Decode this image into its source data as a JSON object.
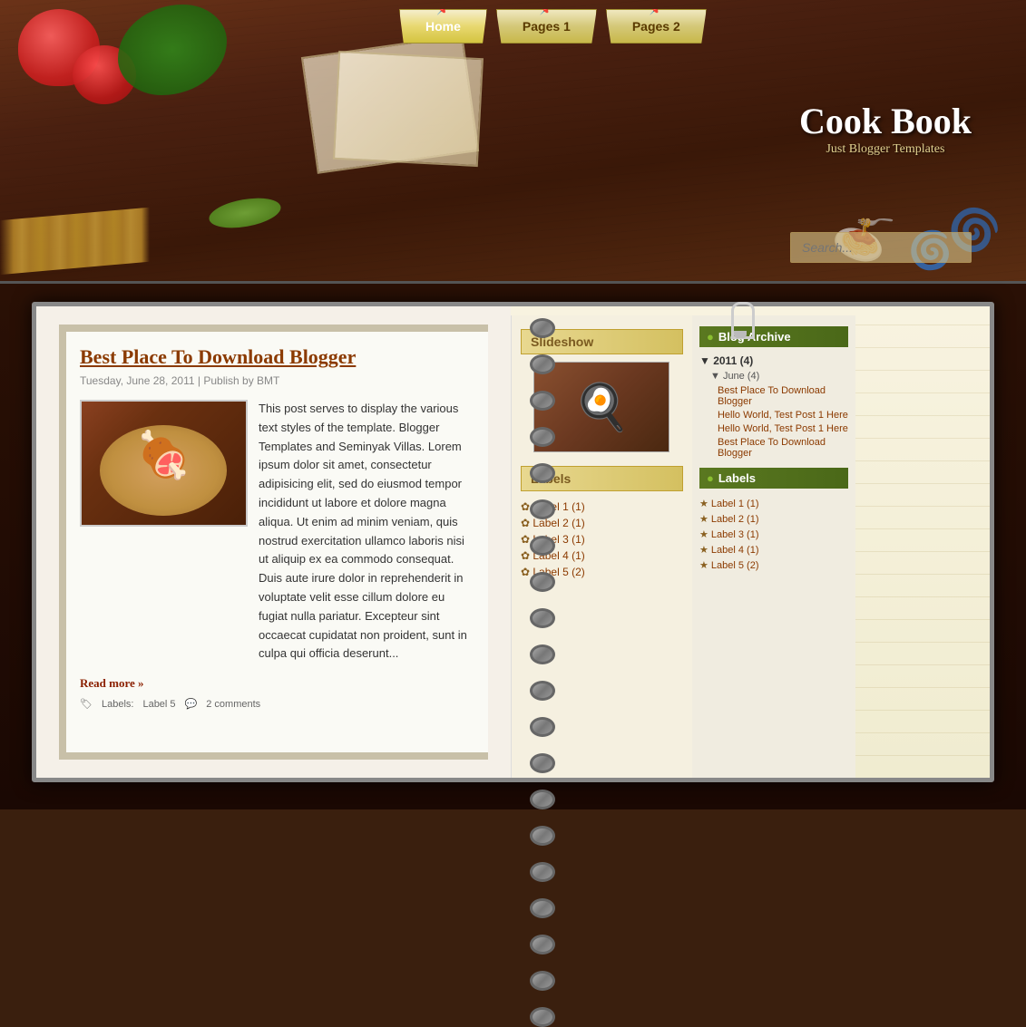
{
  "site": {
    "title": "Cook Book",
    "tagline": "Just Blogger Templates"
  },
  "nav": {
    "items": [
      {
        "label": "Home",
        "active": true
      },
      {
        "label": "Pages 1",
        "active": false
      },
      {
        "label": "Pages 2",
        "active": false
      }
    ]
  },
  "search": {
    "placeholder": "Search..."
  },
  "post": {
    "title": "Best Place To Download Blogger",
    "meta_date": "Tuesday, June 28, 2011",
    "meta_separator": " | ",
    "meta_publish": "Publish by BMT",
    "body_text": "This post serves to display the various text styles of the template. Blogger Templates and Seminyak Villas. Lorem ipsum dolor sit amet, consectetur adipisicing elit, sed do eiusmod tempor incididunt ut labore et dolore magna aliqua. Ut enim ad minim veniam, quis nostrud exercitation ullamco laboris nisi ut aliquip ex ea commodo consequat. Duis aute irure dolor in reprehenderit in voluptate velit esse cillum dolore eu fugiat nulla pariatur. Excepteur sint occaecat cupidatat non proident, sunt in culpa qui officia deserunt...",
    "read_more": "Read more »",
    "labels_prefix": "Labels:",
    "labels_value": "Label 5",
    "comments": "2 comments"
  },
  "slideshow": {
    "title": "Slideshow"
  },
  "labels_widget": {
    "title": "Labels",
    "items": [
      {
        "label": "Label 1",
        "count": "(1)"
      },
      {
        "label": "Label 2",
        "count": "(1)"
      },
      {
        "label": "Label 3",
        "count": "(1)"
      },
      {
        "label": "Label 4",
        "count": "(1)"
      },
      {
        "label": "Label 5",
        "count": "(2)"
      }
    ]
  },
  "blog_archive": {
    "title": "Blog Archive",
    "year": "2011 (4)",
    "month": "June (4)",
    "posts": [
      "Best Place To Download Blogger",
      "Hello World, Test Post 1 Here",
      "Hello World, Test Post 1 Here",
      "Best Place To Download Blogger"
    ]
  },
  "labels_sidebar": {
    "title": "Labels",
    "items": [
      {
        "label": "Label 1",
        "count": "(1)"
      },
      {
        "label": "Label 2",
        "count": "(1)"
      },
      {
        "label": "Label 3",
        "count": "(1)"
      },
      {
        "label": "Label 4",
        "count": "(1)"
      },
      {
        "label": "Label 5",
        "count": "(2)"
      }
    ]
  }
}
